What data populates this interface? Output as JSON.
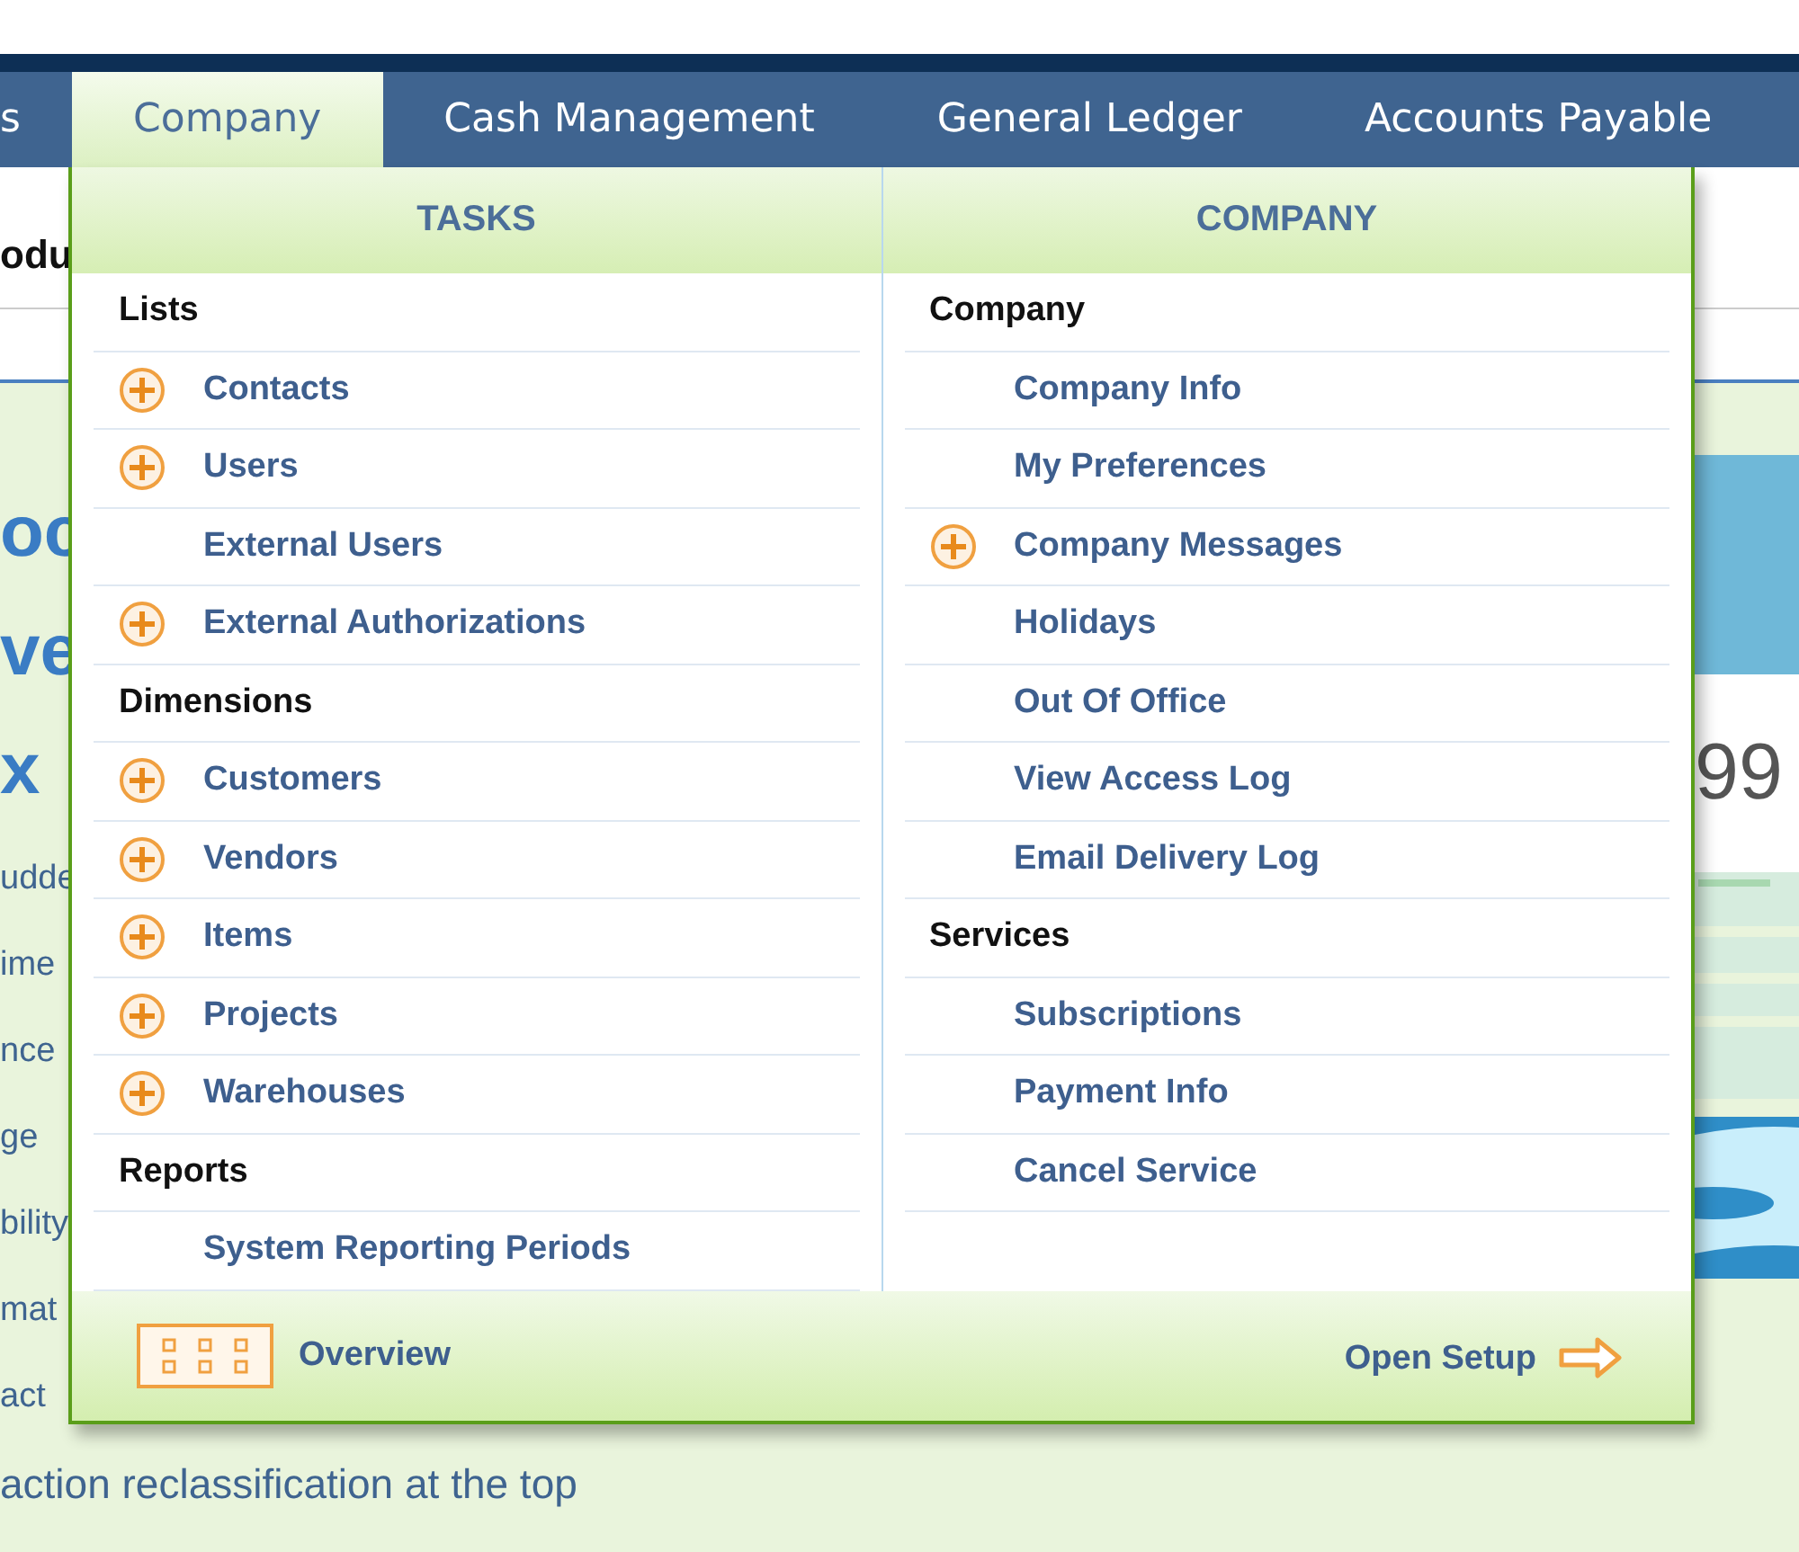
{
  "nav": {
    "tabs": [
      {
        "label": "s",
        "selected": false
      },
      {
        "label": "Company",
        "selected": true
      },
      {
        "label": "Cash Management",
        "selected": false
      },
      {
        "label": "General Ledger",
        "selected": false
      },
      {
        "label": "Accounts Payable",
        "selected": false
      }
    ]
  },
  "page": {
    "heading": "odu",
    "title_lines": [
      "oc",
      "ve",
      "x"
    ],
    "lines": [
      "udde",
      "ime",
      "nce",
      "ge",
      "bility",
      "mat",
      "act"
    ],
    "bottom_line": "action reclassification at the top",
    "figure_number": "99"
  },
  "menu": {
    "columns": [
      {
        "header": "TASKS",
        "rows": [
          {
            "kind": "group",
            "label": "Lists"
          },
          {
            "kind": "item",
            "label": "Contacts",
            "add": true
          },
          {
            "kind": "item",
            "label": "Users",
            "add": true
          },
          {
            "kind": "item",
            "label": "External Users",
            "add": false
          },
          {
            "kind": "item",
            "label": "External Authorizations",
            "add": true
          },
          {
            "kind": "group",
            "label": "Dimensions"
          },
          {
            "kind": "item",
            "label": "Customers",
            "add": true
          },
          {
            "kind": "item",
            "label": "Vendors",
            "add": true
          },
          {
            "kind": "item",
            "label": "Items",
            "add": true
          },
          {
            "kind": "item",
            "label": "Projects",
            "add": true
          },
          {
            "kind": "item",
            "label": "Warehouses",
            "add": true
          },
          {
            "kind": "group",
            "label": "Reports"
          },
          {
            "kind": "item",
            "label": "System Reporting Periods",
            "add": false
          }
        ]
      },
      {
        "header": "COMPANY",
        "rows": [
          {
            "kind": "group",
            "label": "Company"
          },
          {
            "kind": "item",
            "label": "Company Info",
            "add": false
          },
          {
            "kind": "item",
            "label": "My Preferences",
            "add": false
          },
          {
            "kind": "item",
            "label": "Company Messages",
            "add": true
          },
          {
            "kind": "item",
            "label": "Holidays",
            "add": false
          },
          {
            "kind": "item",
            "label": "Out Of Office",
            "add": false
          },
          {
            "kind": "item",
            "label": "View Access Log",
            "add": false
          },
          {
            "kind": "item",
            "label": "Email Delivery Log",
            "add": false
          },
          {
            "kind": "group",
            "label": "Services"
          },
          {
            "kind": "item",
            "label": "Subscriptions",
            "add": false
          },
          {
            "kind": "item",
            "label": "Payment Info",
            "add": false
          },
          {
            "kind": "item",
            "label": "Cancel Service",
            "add": false
          }
        ]
      }
    ],
    "footer": {
      "overview": "Overview",
      "open_setup": "Open Setup"
    }
  }
}
